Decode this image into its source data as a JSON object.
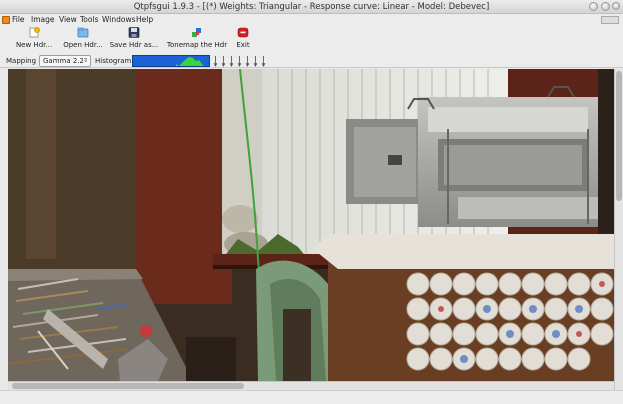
{
  "window": {
    "title": "Qtpfsgui 1.9.3 - [(*) Weights: Triangular - Response curve: Linear - Model: Debevec]"
  },
  "menubar": {
    "items": [
      {
        "label": "File"
      },
      {
        "label": "Image"
      },
      {
        "label": "View"
      },
      {
        "label": "Tools"
      },
      {
        "label": "Windows"
      },
      {
        "label": "Help"
      }
    ]
  },
  "toolbar": {
    "buttons": [
      {
        "label": "New Hdr...",
        "icon": "new-hdr-icon"
      },
      {
        "label": "Open Hdr...",
        "icon": "open-hdr-icon"
      },
      {
        "label": "Save Hdr as...",
        "icon": "save-icon"
      },
      {
        "label": "Tonemap the Hdr",
        "icon": "tonemap-icon"
      },
      {
        "label": "Exit",
        "icon": "exit-icon"
      }
    ]
  },
  "mapping": {
    "mapping_label": "Mapping",
    "gamma_value": "Gamma 2.2",
    "histogram_label": "Histogram"
  },
  "colors": {
    "histogram_bg": "#1a63d6",
    "histogram_fill": "#38d63a",
    "exit_red": "#d42020"
  }
}
